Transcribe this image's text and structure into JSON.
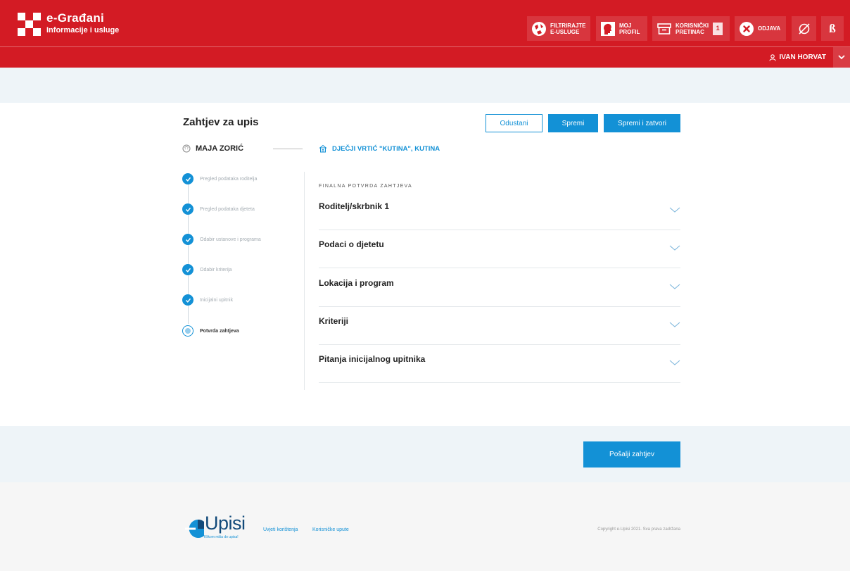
{
  "header": {
    "brand_title": "e-Građani",
    "brand_subtitle": "Informacije i usluge",
    "buttons": {
      "filter": "FILTRIRAJTE\nE-USLUGE",
      "profile": "MOJ\nPROFIL",
      "inbox": "KORISNIČKI\nPRETINAC",
      "inbox_count": "1",
      "logout": "ODJAVA"
    },
    "user_name": "IVAN HORVAT",
    "colors": {
      "brand_red": "#d31b24"
    }
  },
  "page": {
    "title": "Zahtjev za upis",
    "actions": {
      "cancel": "Odustani",
      "save": "Spremi",
      "save_close": "Spremi i zatvori"
    },
    "child_name": "MAJA ZORIĆ",
    "institution": "DJEČJI VRTIĆ \"KUTINA\", KUTINA"
  },
  "steps": [
    {
      "label": "Pregled podataka roditelja",
      "status": "done"
    },
    {
      "label": "Pregled podataka djeteta",
      "status": "done"
    },
    {
      "label": "Odabir ustanove i programa",
      "status": "done"
    },
    {
      "label": "Odabir kriterija",
      "status": "done"
    },
    {
      "label": "Inicijalni upitnik",
      "status": "done"
    },
    {
      "label": "Potvrda zahtjeva",
      "status": "current"
    }
  ],
  "confirmation": {
    "caption": "FINALNA POTVRDA ZAHTJEVA",
    "sections": [
      "Roditelj/skrbnik 1",
      "Podaci o djetetu",
      "Lokacija i program",
      "Kriteriji",
      "Pitanja inicijalnog upitnika"
    ]
  },
  "submit_label": "Pošalji zahtjev",
  "footer": {
    "brand": "Upisi",
    "tagline": "Klikom miša do upisa!",
    "links": [
      "Uvjeti korištenja",
      "Korisničke upute"
    ],
    "copyright": "Copyright e-Upisi 2021. Sva prava zadržana"
  },
  "theme": {
    "accent": "#1391d6",
    "band": "#eef4f8"
  }
}
